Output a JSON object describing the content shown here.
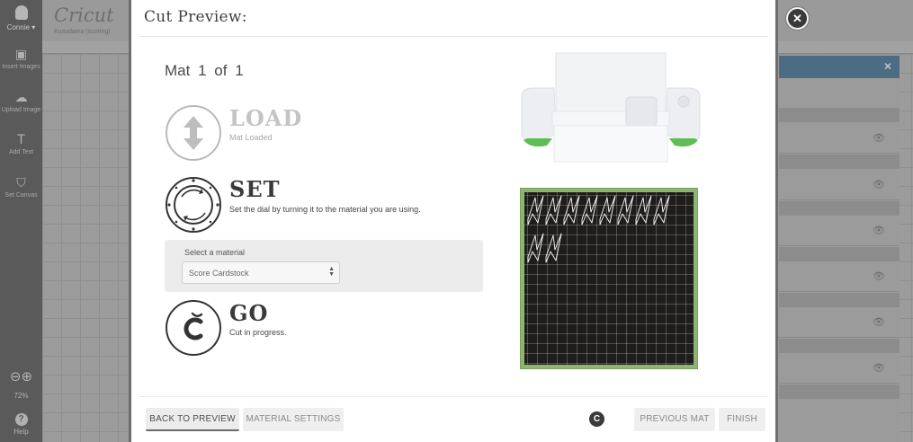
{
  "background": {
    "user_name": "Connie ▾",
    "logo": "Cricut",
    "project_name": "Kusudama (scoring)",
    "rail_items": [
      "Insert Images",
      "Upload Image",
      "Add Text",
      "Set Canvas"
    ],
    "zoom_percent": "72%",
    "help_label": "Help"
  },
  "modal": {
    "title": "Cut Preview:",
    "mat_label": "Mat",
    "mat_current": "1",
    "mat_of": "of",
    "mat_total": "1",
    "steps": {
      "load": {
        "title": "LOAD",
        "desc": "Mat Loaded"
      },
      "set": {
        "title": "SET",
        "desc": "Set the dial by turning it to the material you are using."
      },
      "go": {
        "title": "GO",
        "desc": "Cut in progress."
      }
    },
    "material": {
      "label": "Select a material",
      "selected": "Score Cardstock"
    },
    "buttons": {
      "back": "BACK TO PREVIEW",
      "material_settings": "MATERIAL SETTINGS",
      "previous_mat": "PREVIOUS MAT",
      "finish": "FINISH"
    }
  },
  "colors": {
    "mat_green": "#8cb56f",
    "mat_black": "#1f1c1c",
    "machine_green": "#5fbd55"
  }
}
